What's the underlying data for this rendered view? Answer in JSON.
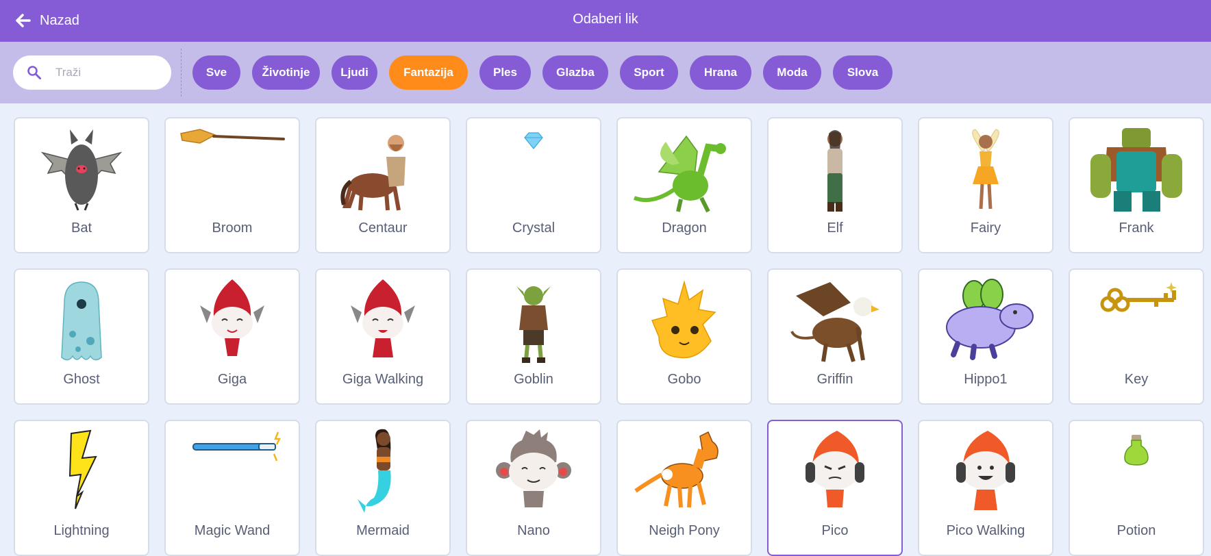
{
  "header": {
    "back_label": "Nazad",
    "title": "Odaberi lik"
  },
  "search": {
    "placeholder": "Traži"
  },
  "tags": [
    {
      "label": "Sve",
      "active": false
    },
    {
      "label": "Životinje",
      "active": false
    },
    {
      "label": "Ljudi",
      "active": false
    },
    {
      "label": "Fantazija",
      "active": true
    },
    {
      "label": "Ples",
      "active": false
    },
    {
      "label": "Glazba",
      "active": false
    },
    {
      "label": "Sport",
      "active": false
    },
    {
      "label": "Hrana",
      "active": false
    },
    {
      "label": "Moda",
      "active": false
    },
    {
      "label": "Slova",
      "active": false
    }
  ],
  "sprites": [
    {
      "name": "Bat",
      "icon": "bat-icon"
    },
    {
      "name": "Broom",
      "icon": "broom-icon"
    },
    {
      "name": "Centaur",
      "icon": "centaur-icon"
    },
    {
      "name": "Crystal",
      "icon": "crystal-icon"
    },
    {
      "name": "Dragon",
      "icon": "dragon-icon"
    },
    {
      "name": "Elf",
      "icon": "elf-icon"
    },
    {
      "name": "Fairy",
      "icon": "fairy-icon"
    },
    {
      "name": "Frank",
      "icon": "frank-icon"
    },
    {
      "name": "Ghost",
      "icon": "ghost-icon"
    },
    {
      "name": "Giga",
      "icon": "giga-icon"
    },
    {
      "name": "Giga Walking",
      "icon": "giga-walking-icon"
    },
    {
      "name": "Goblin",
      "icon": "goblin-icon"
    },
    {
      "name": "Gobo",
      "icon": "gobo-icon"
    },
    {
      "name": "Griffin",
      "icon": "griffin-icon"
    },
    {
      "name": "Hippo1",
      "icon": "hippo-icon"
    },
    {
      "name": "Key",
      "icon": "key-icon"
    },
    {
      "name": "Lightning",
      "icon": "lightning-icon"
    },
    {
      "name": "Magic Wand",
      "icon": "magic-wand-icon"
    },
    {
      "name": "Mermaid",
      "icon": "mermaid-icon"
    },
    {
      "name": "Nano",
      "icon": "nano-icon"
    },
    {
      "name": "Neigh Pony",
      "icon": "neigh-pony-icon"
    },
    {
      "name": "Pico",
      "icon": "pico-icon",
      "selected": true
    },
    {
      "name": "Pico Walking",
      "icon": "pico-walking-icon"
    },
    {
      "name": "Potion",
      "icon": "potion-icon"
    }
  ],
  "colors": {
    "header": "#855cd6",
    "filter_bar": "#c5bde9",
    "tag": "#855cd6",
    "tag_active": "#ff8c1a",
    "background": "#e9f0fb",
    "label_text": "#575e75"
  }
}
